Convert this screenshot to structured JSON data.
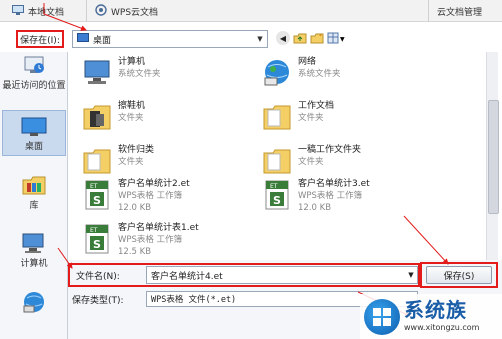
{
  "tabs": {
    "local": "本地文档",
    "wps_cloud": "WPS云文档",
    "cloud_manage": "云文档管理"
  },
  "save_in": {
    "label": "保存在(I):",
    "value": "桌面"
  },
  "places": [
    {
      "label": "最近访问的位置"
    },
    {
      "label": "桌面"
    },
    {
      "label": "库"
    },
    {
      "label": "计算机"
    }
  ],
  "files": [
    {
      "name": "计算机",
      "type": "系统文件夹",
      "size": "",
      "icon": "computer-icon"
    },
    {
      "name": "网络",
      "type": "系统文件夹",
      "size": "",
      "icon": "network-icon"
    },
    {
      "name": "擦鞋机",
      "type": "文件夹",
      "size": "",
      "icon": "folder-icon"
    },
    {
      "name": "工作文档",
      "type": "文件夹",
      "size": "",
      "icon": "folder-icon"
    },
    {
      "name": "软件归类",
      "type": "文件夹",
      "size": "",
      "icon": "folder-icon"
    },
    {
      "name": "一稿工作文件夹",
      "type": "文件夹",
      "size": "",
      "icon": "folder-icon"
    },
    {
      "name": "客户名单统计2.et",
      "type": "WPS表格 工作簿",
      "size": "12.0 KB",
      "icon": "et-file-icon"
    },
    {
      "name": "客户名单统计3.et",
      "type": "WPS表格 工作簿",
      "size": "12.0 KB",
      "icon": "et-file-icon"
    },
    {
      "name": "客户名单统计表1.et",
      "type": "WPS表格 工作簿",
      "size": "12.5 KB",
      "icon": "et-file-icon"
    }
  ],
  "filename": {
    "label": "文件名(N):",
    "value": "客户名单统计4.et"
  },
  "filetype": {
    "label": "保存类型(T):",
    "value": "WPS表格 文件(*.et)"
  },
  "save_button": "保存(S)",
  "watermark": {
    "main": "系统族",
    "url": "www.xitongzu.com"
  },
  "colors": {
    "annotation": "#e31b1b",
    "selection": "#c9d9ee",
    "et_icon": "#3a7d3a"
  }
}
